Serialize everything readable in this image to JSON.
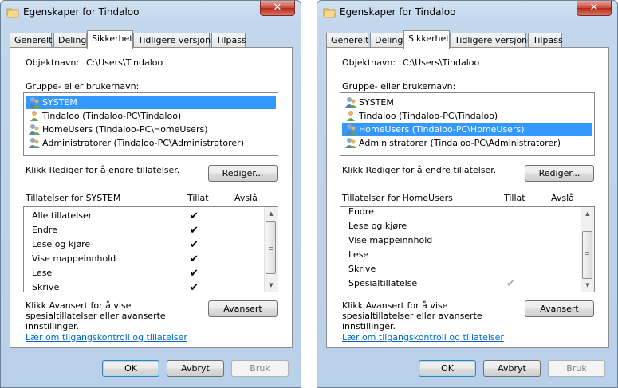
{
  "dialogs": [
    {
      "title": "Egenskaper for Tindaloo",
      "tabs": [
        "Generelt",
        "Deling",
        "Sikkerhet",
        "Tidligere versjoner",
        "Tilpass"
      ],
      "active_tab": "Sikkerhet",
      "object_label": "Objektnavn:",
      "object_value": "C:\\Users\\Tindaloo",
      "group_label": "Gruppe- eller brukernavn:",
      "users": [
        {
          "name": "SYSTEM",
          "selected": true
        },
        {
          "name": "Tindaloo (Tindaloo-PC\\Tindaloo)",
          "selected": false
        },
        {
          "name": "HomeUsers (Tindaloo-PC\\HomeUsers)",
          "selected": false
        },
        {
          "name": "Administratorer (Tindaloo-PC\\Administratorer)",
          "selected": false
        }
      ],
      "edit_hint": "Klikk Rediger for å endre tillatelser.",
      "edit_button": "Rediger...",
      "perm_header": "Tillatelser for SYSTEM",
      "allow_header": "Tillat",
      "deny_header": "Avslå",
      "permissions": [
        {
          "name": "Alle tillatelser",
          "allow": "✔",
          "deny": ""
        },
        {
          "name": "Endre",
          "allow": "✔",
          "deny": ""
        },
        {
          "name": "Lese og kjøre",
          "allow": "✔",
          "deny": ""
        },
        {
          "name": "Vise mappeinnhold",
          "allow": "✔",
          "deny": ""
        },
        {
          "name": "Lese",
          "allow": "✔",
          "deny": ""
        },
        {
          "name": "Skrive",
          "allow": "✔",
          "deny": ""
        }
      ],
      "advanced_hint": "Klikk Avansert for å vise spesialtillatelser eller avanserte innstillinger.",
      "advanced_button": "Avansert",
      "learn_link": "Lær om tilgangskontroll og tillatelser",
      "ok_button": "OK",
      "cancel_button": "Avbryt",
      "apply_button": "Bruk"
    },
    {
      "title": "Egenskaper for Tindaloo",
      "tabs": [
        "Generelt",
        "Deling",
        "Sikkerhet",
        "Tidligere versjoner",
        "Tilpass"
      ],
      "active_tab": "Sikkerhet",
      "object_label": "Objektnavn:",
      "object_value": "C:\\Users\\Tindaloo",
      "group_label": "Gruppe- eller brukernavn:",
      "users": [
        {
          "name": "SYSTEM",
          "selected": false
        },
        {
          "name": "Tindaloo (Tindaloo-PC\\Tindaloo)",
          "selected": false
        },
        {
          "name": "HomeUsers (Tindaloo-PC\\HomeUsers)",
          "selected": true
        },
        {
          "name": "Administratorer (Tindaloo-PC\\Administratorer)",
          "selected": false
        }
      ],
      "edit_hint": "Klikk Rediger for å endre tillatelser.",
      "edit_button": "Rediger...",
      "perm_header": "Tillatelser for HomeUsers",
      "allow_header": "Tillat",
      "deny_header": "Avslå",
      "permissions": [
        {
          "name": "Endre",
          "allow": "",
          "deny": ""
        },
        {
          "name": "Lese og kjøre",
          "allow": "",
          "deny": ""
        },
        {
          "name": "Vise mappeinnhold",
          "allow": "",
          "deny": ""
        },
        {
          "name": "Lese",
          "allow": "",
          "deny": ""
        },
        {
          "name": "Skrive",
          "allow": "",
          "deny": ""
        },
        {
          "name": "Spesialtillatelse",
          "allow": "✔",
          "deny": "",
          "inherited": true
        }
      ],
      "advanced_hint": "Klikk Avansert for å vise spesialtillatelser eller avanserte innstillinger.",
      "advanced_button": "Avansert",
      "learn_link": "Lær om tilgangskontroll og tillatelser",
      "ok_button": "OK",
      "cancel_button": "Avbryt",
      "apply_button": "Bruk"
    }
  ],
  "icons": {
    "window": "folder-icon",
    "user": "users-group-icon",
    "close": "close-icon"
  },
  "colors": {
    "selection": "#3399ff",
    "link": "#0066cc",
    "close": "#c7493a"
  }
}
